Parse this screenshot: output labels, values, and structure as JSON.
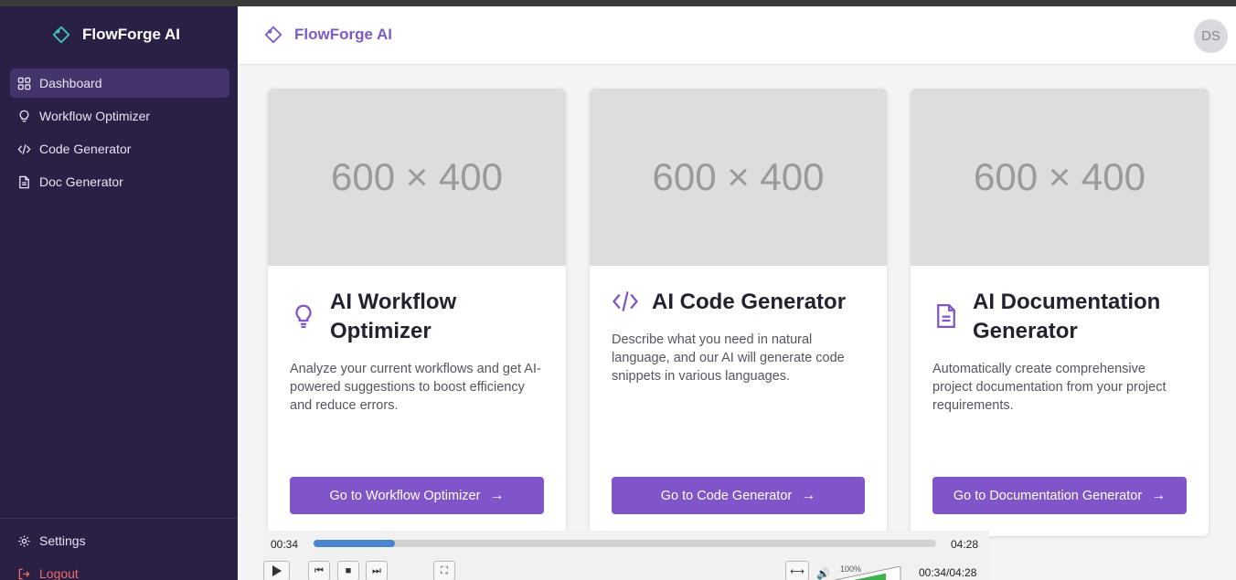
{
  "app": {
    "name": "FlowForge AI"
  },
  "sidebar": {
    "items": [
      {
        "label": "Dashboard",
        "icon": "dashboard-grid-icon",
        "active": true
      },
      {
        "label": "Workflow Optimizer",
        "icon": "lightbulb-icon"
      },
      {
        "label": "Code Generator",
        "icon": "code-icon"
      },
      {
        "label": "Doc Generator",
        "icon": "document-icon"
      }
    ],
    "settings": "Settings",
    "logout": "Logout"
  },
  "header": {
    "title": "FlowForge AI",
    "avatar": "DS"
  },
  "cards": [
    {
      "placeholder": "600 × 400",
      "title": "AI Workflow Optimizer",
      "icon": "lightbulb-icon",
      "description": "Analyze your current workflows and get AI-powered suggestions to boost efficiency and reduce errors.",
      "button": "Go to Workflow Optimizer"
    },
    {
      "placeholder": "600 × 400",
      "title": "AI Code Generator",
      "icon": "code-icon",
      "description": "Describe what you need in natural language, and our AI will generate code snippets in various languages.",
      "button": "Go to Code Generator"
    },
    {
      "placeholder": "600 × 400",
      "title": "AI Documentation Generator",
      "icon": "document-icon",
      "description": "Automatically create comprehensive project documentation from your project requirements.",
      "button": "Go to Documentation Generator"
    }
  ],
  "player": {
    "current": "00:34",
    "duration": "04:28",
    "progress": 0.13,
    "volume": "100%",
    "time_readout": "00:34/04:28"
  },
  "colors": {
    "sidebar": "#2a1f44",
    "accent": "#7f55c9",
    "brand_text": "#7d5bc6",
    "logo": "#3ec7c0",
    "logout": "#f06a6a"
  }
}
